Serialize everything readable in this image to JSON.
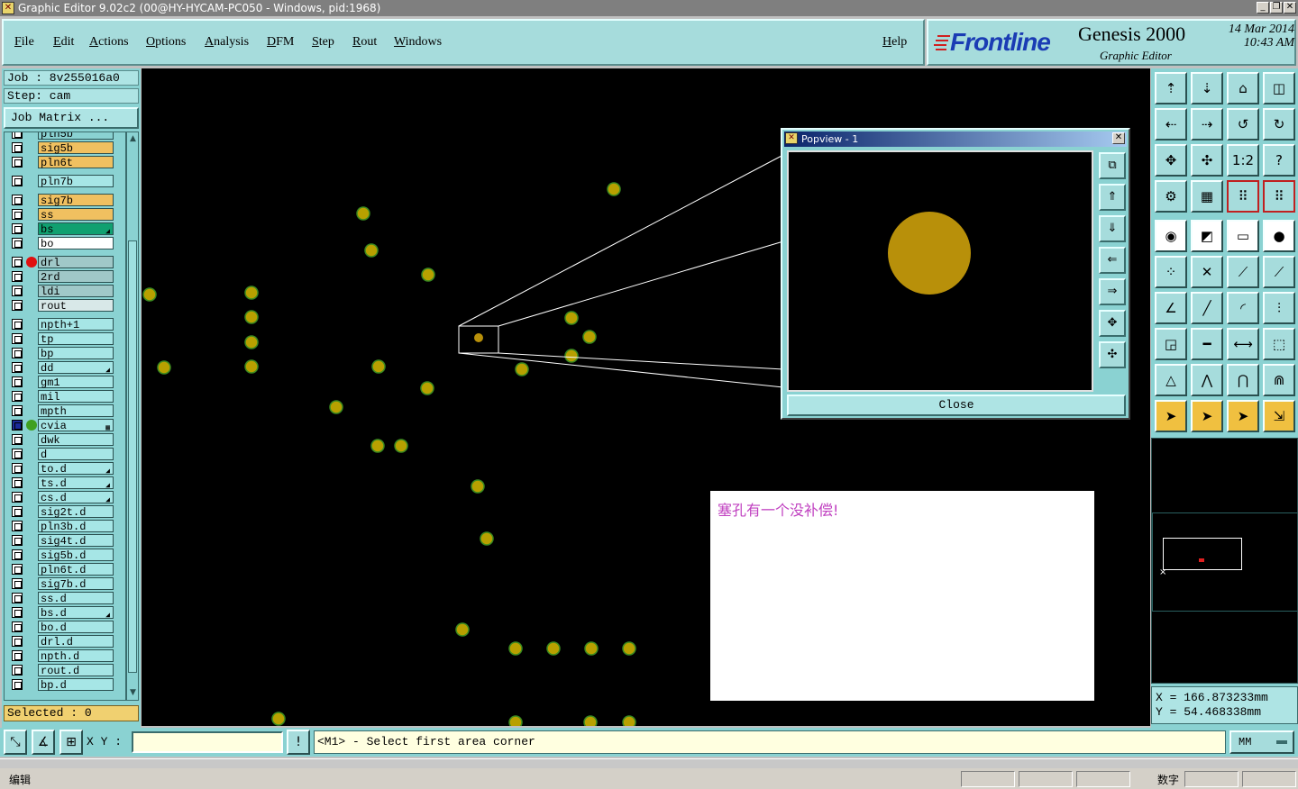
{
  "window": {
    "title": "Graphic Editor 9.02c2 (00@HY-HYCAM-PC050 - Windows, pid:1968)"
  },
  "menu": [
    "File",
    "Edit",
    "Actions",
    "Options",
    "Analysis",
    "DFM",
    "Step",
    "Rout",
    "Windows"
  ],
  "help_label": "Help",
  "brand": {
    "logo": "Frontline",
    "product": "Genesis 2000",
    "subtitle": "Graphic Editor",
    "date": "14 Mar 2014",
    "time": "10:43 AM"
  },
  "job": {
    "job_label": "Job : 8v255016a0",
    "step_label": "Step: cam",
    "matrix_button": "Job Matrix ..."
  },
  "layers": [
    {
      "name": "pln5b",
      "color": "#8ad2d2",
      "dot": "",
      "mark": ""
    },
    {
      "name": "sig5b",
      "color": "#f0c060",
      "dot": "",
      "mark": ""
    },
    {
      "name": "pln6t",
      "color": "#f0c060",
      "dot": "",
      "mark": ""
    },
    {
      "name": "pln7b",
      "color": "#a6e6e6",
      "dot": "",
      "mark": ""
    },
    {
      "name": "sig7b",
      "color": "#f0c060",
      "dot": "",
      "mark": ""
    },
    {
      "name": "ss",
      "color": "#f0c060",
      "dot": "",
      "mark": ""
    },
    {
      "name": "bs",
      "color": "#10a070",
      "dot": "",
      "mark": "◢"
    },
    {
      "name": "bo",
      "color": "#ffffff",
      "dot": "",
      "mark": ""
    },
    {
      "name": "drl",
      "color": "#a0c8c8",
      "dot": "#e01010",
      "mark": ""
    },
    {
      "name": "2rd",
      "color": "#a0c8c8",
      "dot": "",
      "mark": ""
    },
    {
      "name": "ldi",
      "color": "#a0c8c8",
      "dot": "",
      "mark": ""
    },
    {
      "name": "rout",
      "color": "#d8e8e8",
      "dot": "",
      "mark": ""
    },
    {
      "name": "npth+1",
      "color": "#a6e6e6",
      "dot": "",
      "mark": ""
    },
    {
      "name": "tp",
      "color": "#a6e6e6",
      "dot": "",
      "mark": ""
    },
    {
      "name": "bp",
      "color": "#a6e6e6",
      "dot": "",
      "mark": ""
    },
    {
      "name": "dd",
      "color": "#a6e6e6",
      "dot": "",
      "mark": "◢"
    },
    {
      "name": "gm1",
      "color": "#a6e6e6",
      "dot": "",
      "mark": ""
    },
    {
      "name": "mil",
      "color": "#a6e6e6",
      "dot": "",
      "mark": ""
    },
    {
      "name": "mpth",
      "color": "#a6e6e6",
      "dot": "",
      "mark": ""
    },
    {
      "name": "cvia",
      "color": "#a6e6e6",
      "dot": "#40a020",
      "mark": "▦",
      "active": true
    },
    {
      "name": "dwk",
      "color": "#a6e6e6",
      "dot": "",
      "mark": ""
    },
    {
      "name": "d",
      "color": "#a6e6e6",
      "dot": "",
      "mark": ""
    },
    {
      "name": "to.d",
      "color": "#a6e6e6",
      "dot": "",
      "mark": "◢"
    },
    {
      "name": "ts.d",
      "color": "#a6e6e6",
      "dot": "",
      "mark": "◢"
    },
    {
      "name": "cs.d",
      "color": "#a6e6e6",
      "dot": "",
      "mark": "◢"
    },
    {
      "name": "sig2t.d",
      "color": "#a6e6e6",
      "dot": "",
      "mark": ""
    },
    {
      "name": "pln3b.d",
      "color": "#a6e6e6",
      "dot": "",
      "mark": ""
    },
    {
      "name": "sig4t.d",
      "color": "#a6e6e6",
      "dot": "",
      "mark": ""
    },
    {
      "name": "sig5b.d",
      "color": "#a6e6e6",
      "dot": "",
      "mark": ""
    },
    {
      "name": "pln6t.d",
      "color": "#a6e6e6",
      "dot": "",
      "mark": ""
    },
    {
      "name": "sig7b.d",
      "color": "#a6e6e6",
      "dot": "",
      "mark": ""
    },
    {
      "name": "ss.d",
      "color": "#a6e6e6",
      "dot": "",
      "mark": ""
    },
    {
      "name": "bs.d",
      "color": "#a6e6e6",
      "dot": "",
      "mark": "◢"
    },
    {
      "name": "bo.d",
      "color": "#a6e6e6",
      "dot": "",
      "mark": ""
    },
    {
      "name": "drl.d",
      "color": "#a6e6e6",
      "dot": "",
      "mark": ""
    },
    {
      "name": "npth.d",
      "color": "#a6e6e6",
      "dot": "",
      "mark": ""
    },
    {
      "name": "rout.d",
      "color": "#a6e6e6",
      "dot": "",
      "mark": ""
    },
    {
      "name": "bp.d",
      "color": "#a6e6e6",
      "dot": "",
      "mark": ""
    }
  ],
  "selected_label": "Selected : 0",
  "popview": {
    "title": "Popview - 1",
    "close_button": "Close"
  },
  "note": "塞孔有一个没补偿!",
  "coords": {
    "x": "X  =  166.873233mm",
    "y": "Y  =  54.468338mm"
  },
  "status": {
    "xy_label": "X Y :",
    "xy_value": "",
    "prompt": "<M1> - Select first area corner",
    "units": "MM"
  },
  "ime": {
    "left": "编辑",
    "right": "数字"
  },
  "colors": {
    "pad": "#b8a000",
    "canvas": "#000000",
    "panel": "#8ad2d2"
  }
}
